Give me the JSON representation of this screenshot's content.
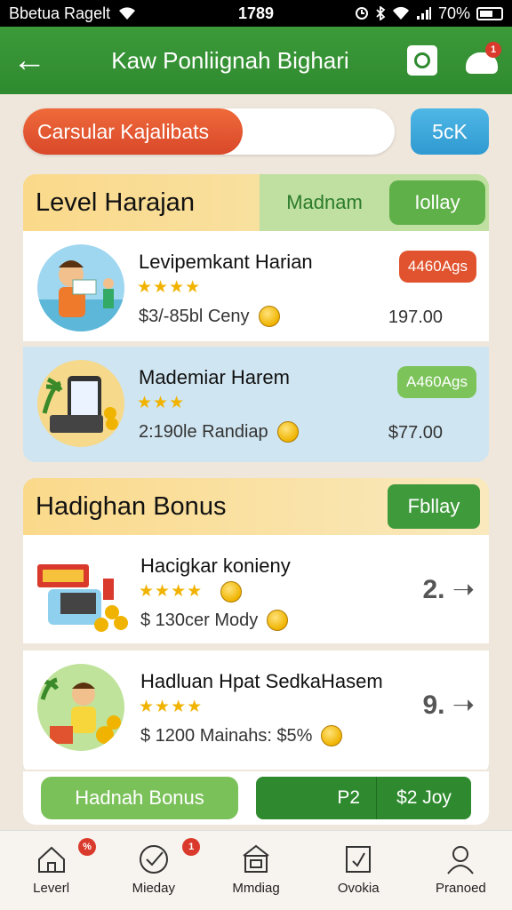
{
  "status_bar": {
    "carrier": "Bbetua Ragelt",
    "time": "1789",
    "battery": "70%"
  },
  "header": {
    "back_label": "←",
    "title": "Kaw Ponliignah Bighari",
    "notification_count": "1"
  },
  "search": {
    "value": "Carsular Kajalibats",
    "button_label": "5cK",
    "fill": 0.59
  },
  "sections": [
    {
      "title": "Level Harajan",
      "tab_inactive": "Madnam",
      "tab_active": "Iollay",
      "items": [
        {
          "title": "Levipemkant Harian",
          "rating": "★★★★",
          "subtitle": "$3/-85bl Ceny",
          "badge": "4460Ags",
          "badge_color": "#e0532e",
          "price": "197.00"
        },
        {
          "title": "Mademiar Harem",
          "rating": "★★★",
          "subtitle": "2:190le Randiap",
          "badge": "A460Ags",
          "badge_color": "#7cc35a",
          "price": "$77.00"
        }
      ]
    },
    {
      "title": "Hadighan Bonus",
      "tab_active": "Fbllay",
      "items": [
        {
          "title": "Hacigkar konieny",
          "rating": "★★★★",
          "subtitle": "$ 130cer Mody",
          "count": "2."
        },
        {
          "title": "Hadluan Hpat SedkaHasem",
          "rating": "★★★★",
          "subtitle": "$ 1200 Mainahs: $5%",
          "count": "9."
        }
      ]
    }
  ],
  "actions": {
    "bonus_button": "Hadnah Bonus",
    "split_left": "P2",
    "split_right": "$2 Joy"
  },
  "bottom_nav": [
    {
      "label": "Leverl",
      "badge": "%"
    },
    {
      "label": "Mieday",
      "badge": "1"
    },
    {
      "label": "Mmdiag"
    },
    {
      "label": "Ovokia"
    },
    {
      "label": "Pranoed"
    }
  ]
}
